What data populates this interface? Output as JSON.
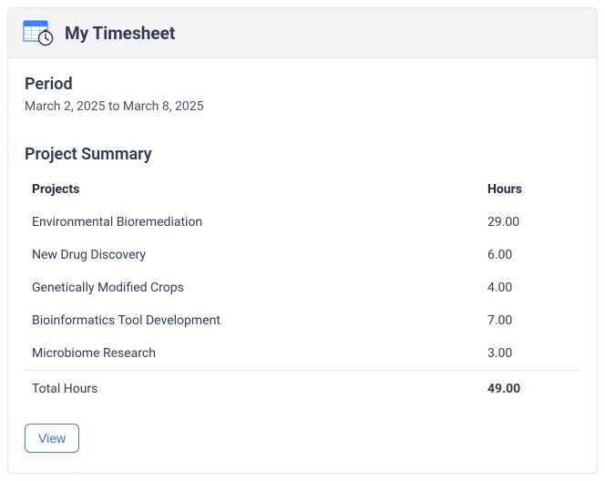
{
  "header": {
    "title": "My Timesheet"
  },
  "period": {
    "heading": "Period",
    "range_text": "March 2, 2025 to March 8, 2025"
  },
  "summary": {
    "heading": "Project Summary",
    "columns": {
      "projects": "Projects",
      "hours": "Hours"
    },
    "rows": [
      {
        "project": "Environmental Bioremediation",
        "hours": "29.00"
      },
      {
        "project": "New Drug Discovery",
        "hours": "6.00"
      },
      {
        "project": "Genetically Modified Crops",
        "hours": "4.00"
      },
      {
        "project": "Bioinformatics Tool Development",
        "hours": "7.00"
      },
      {
        "project": "Microbiome Research",
        "hours": "3.00"
      }
    ],
    "total": {
      "label": "Total Hours",
      "hours": "49.00"
    }
  },
  "actions": {
    "view_label": "View"
  },
  "colors": {
    "heading": "#2f3b52",
    "text": "#323e52",
    "muted": "#4a5568",
    "border": "#e3e6eb",
    "accent": "#2f6fe0"
  }
}
